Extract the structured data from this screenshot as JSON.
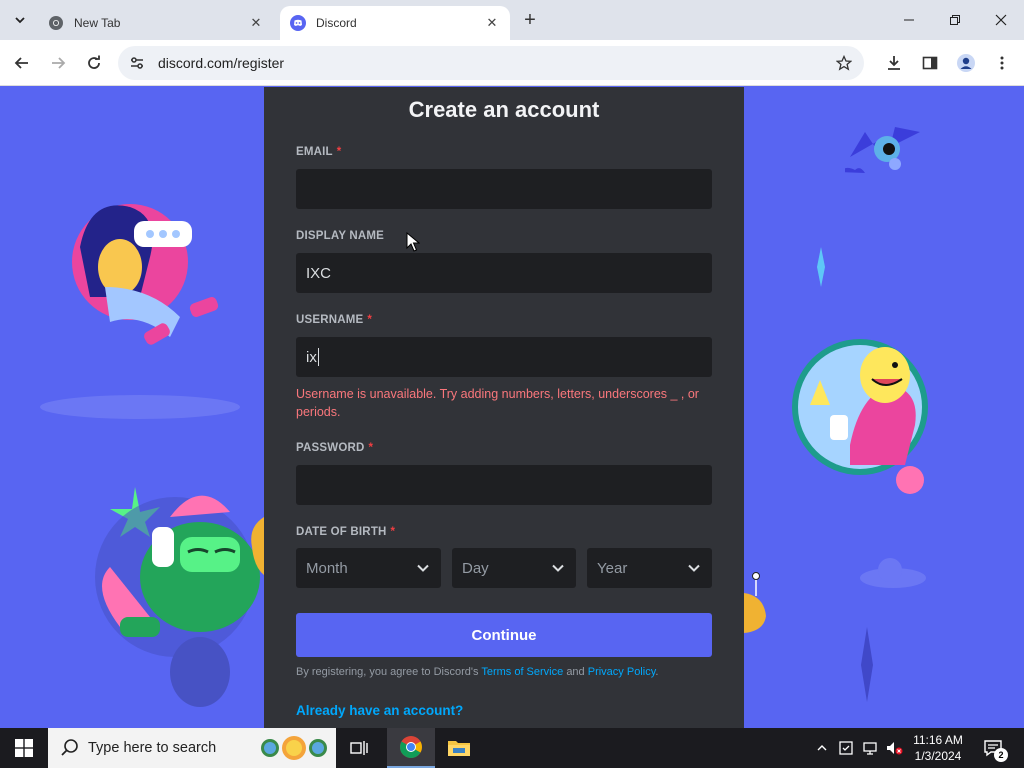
{
  "browser": {
    "tabs": [
      {
        "title": "New Tab"
      },
      {
        "title": "Discord"
      }
    ],
    "url": "discord.com/register"
  },
  "form": {
    "heading": "Create an account",
    "email": {
      "label": "EMAIL",
      "required_mark": "*",
      "value": ""
    },
    "display_name": {
      "label": "DISPLAY NAME",
      "value": "IXC"
    },
    "username": {
      "label": "USERNAME",
      "required_mark": "*",
      "value": "ix",
      "error": "Username is unavailable. Try adding numbers, letters, underscores _ , or periods."
    },
    "password": {
      "label": "PASSWORD",
      "required_mark": "*",
      "value": ""
    },
    "dob": {
      "label": "DATE OF BIRTH",
      "required_mark": "*",
      "month_placeholder": "Month",
      "day_placeholder": "Day",
      "year_placeholder": "Year"
    },
    "continue_label": "Continue",
    "terms": {
      "prefix": "By registering, you agree to Discord's",
      "tos": "Terms of Service",
      "and": "and",
      "privacy": "Privacy Policy",
      "suffix": "."
    },
    "login_link": "Already have an account?"
  },
  "taskbar": {
    "search_placeholder": "Type here to search",
    "time": "11:16 AM",
    "date": "1/3/2024",
    "notification_count": "2"
  },
  "colors": {
    "brand": "#5865f2",
    "card": "#313338",
    "input_bg": "#1e1f22",
    "error": "#fa777c",
    "link": "#00a8fc"
  }
}
